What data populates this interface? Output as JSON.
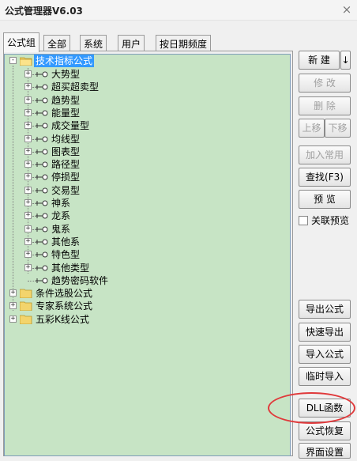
{
  "window": {
    "title": "公式管理器V6.03",
    "close_glyph": "×"
  },
  "tabs": [
    {
      "label": "公式组",
      "active": true
    },
    {
      "label": "全部",
      "active": false
    },
    {
      "label": "系统",
      "active": false
    },
    {
      "label": "用户",
      "active": false
    },
    {
      "label": "按日期频度",
      "active": false
    }
  ],
  "tree": {
    "root": {
      "label": "技术指标公式",
      "expander": "-",
      "selected": true
    },
    "children": [
      {
        "label": "大势型",
        "expander": "+"
      },
      {
        "label": "超买超卖型",
        "expander": "+"
      },
      {
        "label": "趋势型",
        "expander": "+"
      },
      {
        "label": "能量型",
        "expander": "+"
      },
      {
        "label": "成交量型",
        "expander": "+"
      },
      {
        "label": "均线型",
        "expander": "+"
      },
      {
        "label": "图表型",
        "expander": "+"
      },
      {
        "label": "路径型",
        "expander": "+"
      },
      {
        "label": "停损型",
        "expander": "+"
      },
      {
        "label": "交易型",
        "expander": "+"
      },
      {
        "label": "神系",
        "expander": "+"
      },
      {
        "label": "龙系",
        "expander": "+"
      },
      {
        "label": "鬼系",
        "expander": "+"
      },
      {
        "label": "其他系",
        "expander": "+"
      },
      {
        "label": "特色型",
        "expander": "+"
      },
      {
        "label": "其他类型",
        "expander": "+"
      },
      {
        "label": "趋势密码软件",
        "expander": ""
      }
    ],
    "siblings": [
      {
        "label": "条件选股公式",
        "expander": "+"
      },
      {
        "label": "专家系统公式",
        "expander": "+"
      },
      {
        "label": "五彩K线公式",
        "expander": "+"
      }
    ]
  },
  "buttons": {
    "new": "新  建",
    "new_dropdown": "↓",
    "modify": "修  改",
    "delete": "删  除",
    "move_up": "上移",
    "move_down": "下移",
    "add_common": "加入常用",
    "find": "查找(F3)",
    "preview": "预  览",
    "export": "导出公式",
    "quick_export": "快速导出",
    "import": "导入公式",
    "temp_import": "临时导入",
    "dll": "DLL函数",
    "restore": "公式恢复",
    "interface": "界面设置"
  },
  "linked_preview": {
    "label": "关联预览",
    "checked": false
  },
  "colors": {
    "tree_bg": "#c7e4c5",
    "selection": "#3399ff",
    "highlight_circle": "#e0393b"
  }
}
